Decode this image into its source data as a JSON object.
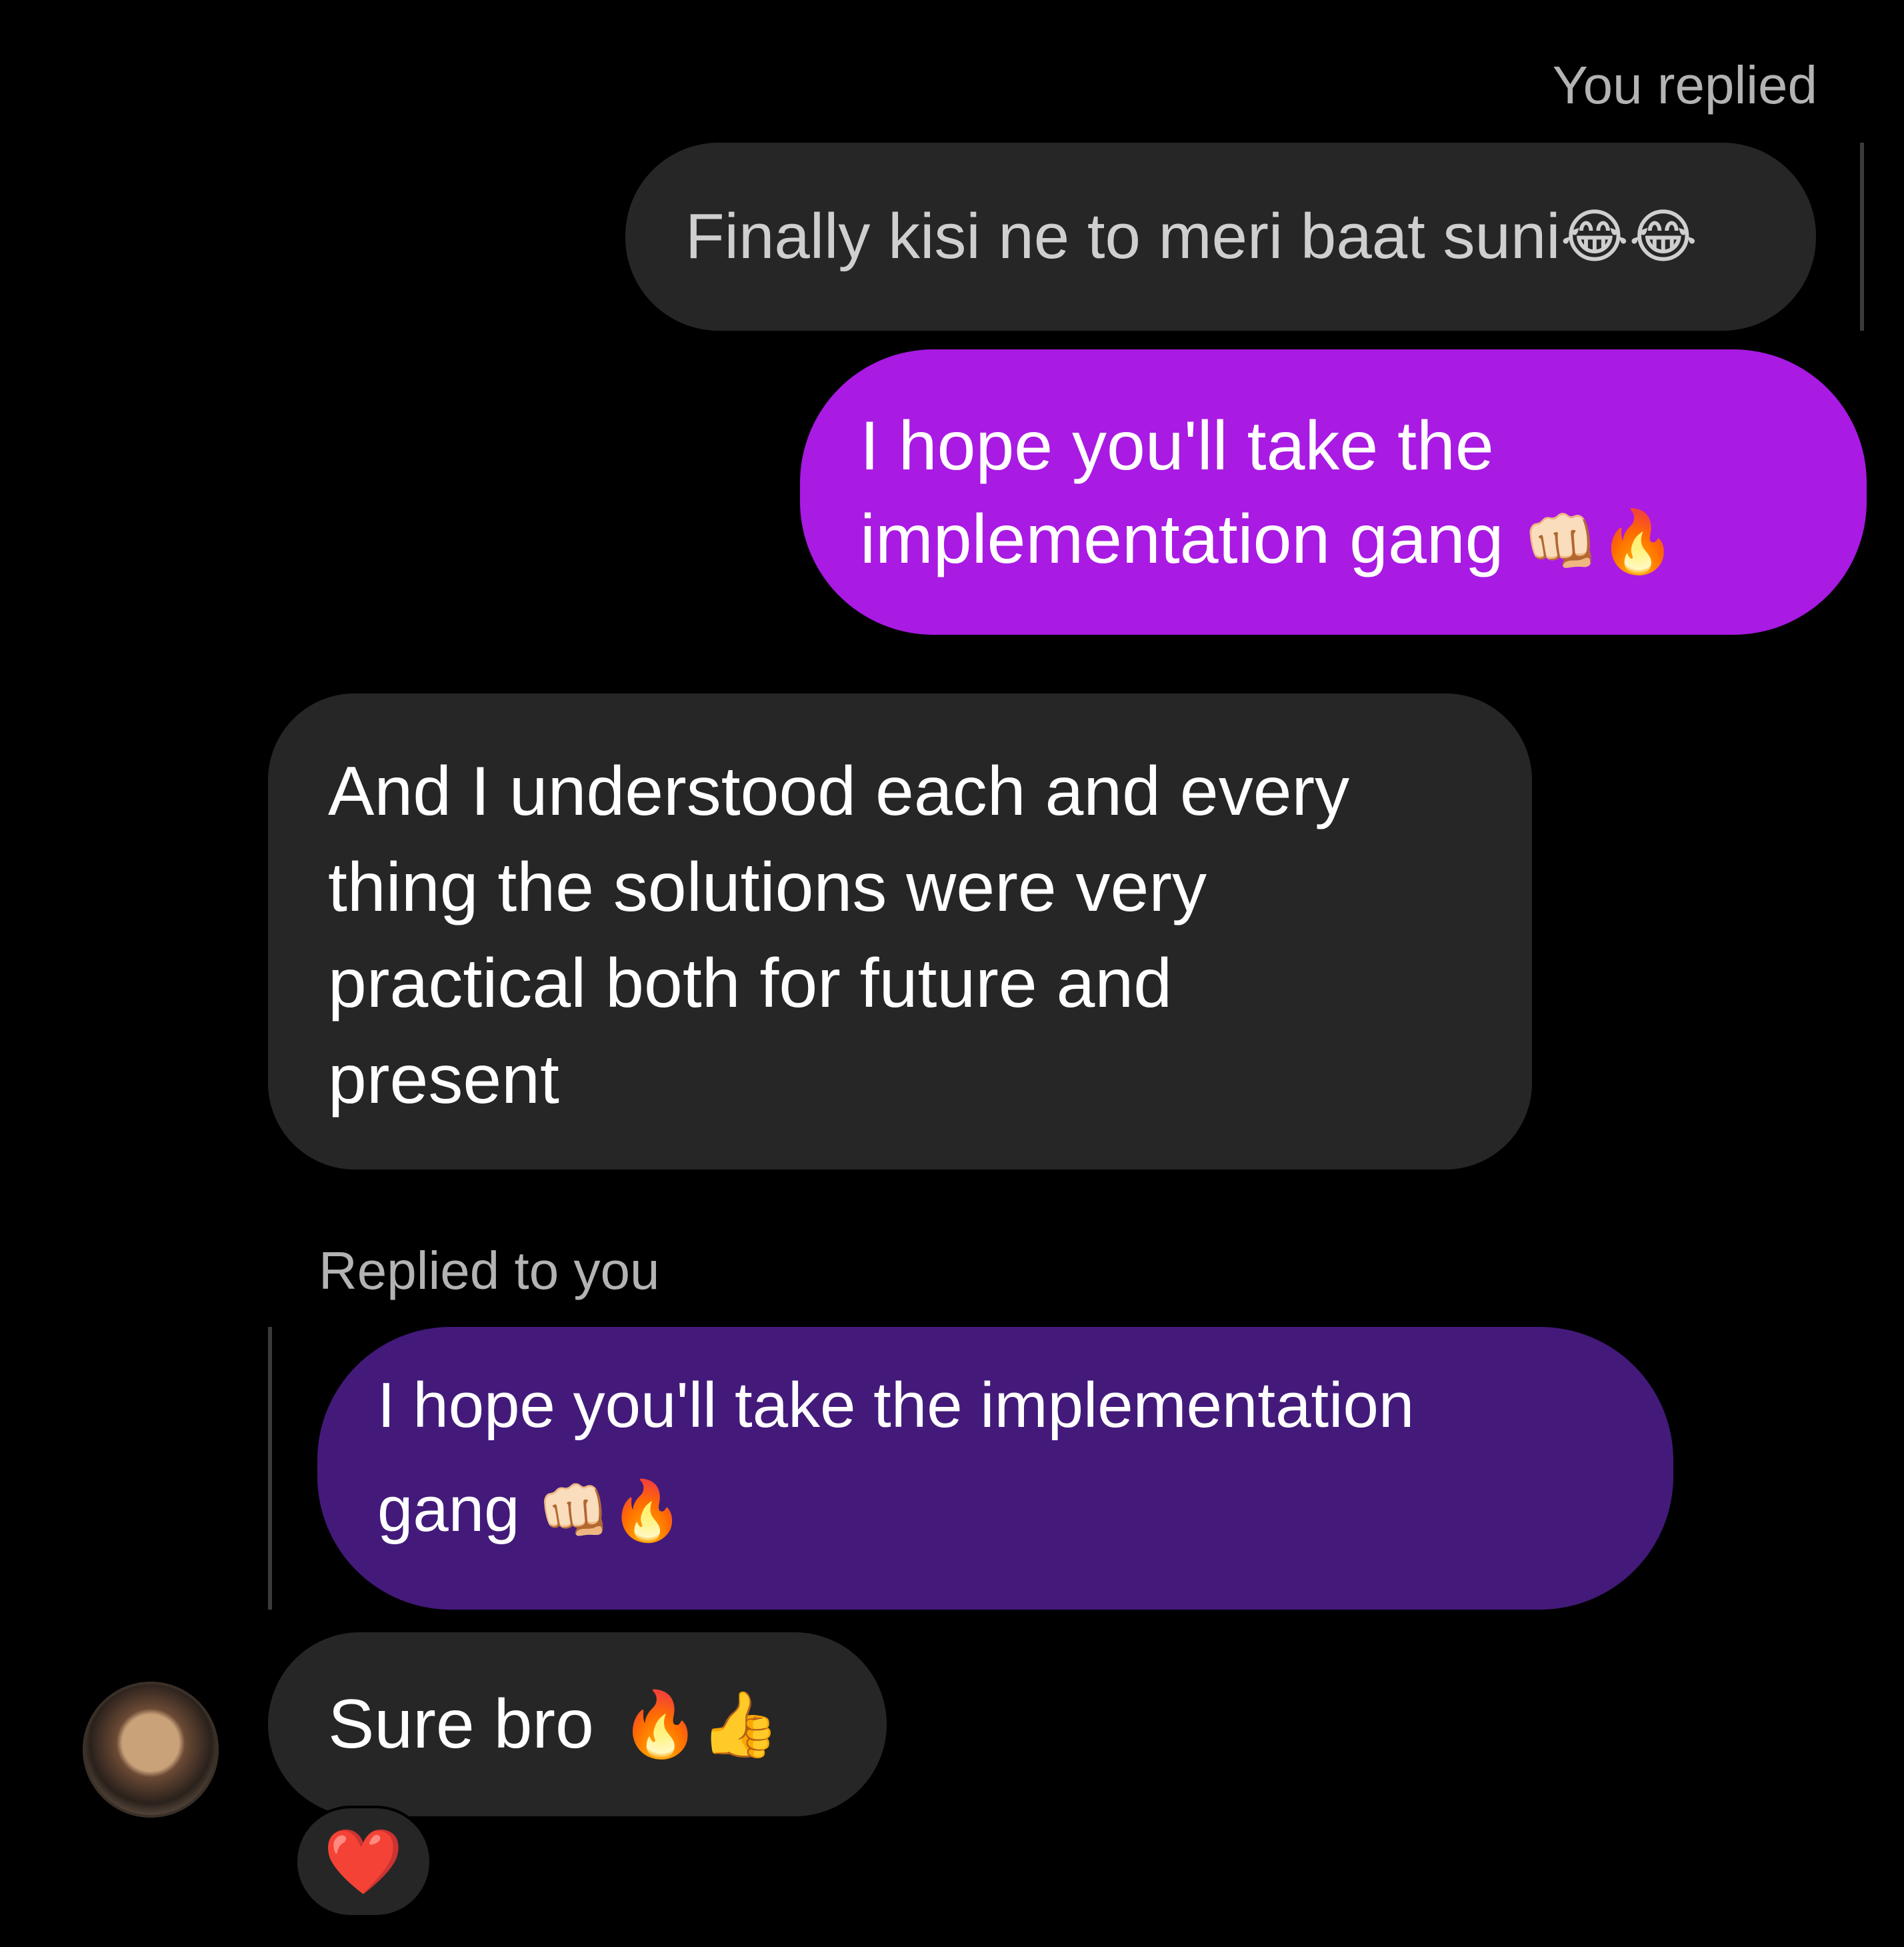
{
  "reply_caption_sent": "You replied",
  "quoted_message": {
    "text": "Finally kisi ne to meri baat suni",
    "emoji": "😂😂"
  },
  "sent_message": {
    "line1": "I hope you'll take the",
    "line2": "implementation gang",
    "emoji": "👊🏻🔥"
  },
  "received_message": {
    "line1": "And I understood each and every",
    "line2": "thing the solutions were very",
    "line3": "practical both for future and",
    "line4": "present"
  },
  "reply_caption_received": "Replied to you",
  "replied_message": {
    "line1": "I hope you'll take the implementation",
    "line2": "gang",
    "emoji": "👊🏻🔥"
  },
  "last_message": {
    "text": "Sure bro",
    "emoji": "🔥👍"
  },
  "reaction": {
    "emoji": "❤️"
  },
  "colors": {
    "background": "#000000",
    "sent_bubble": "#a91ae3",
    "received_bubble": "#262626",
    "replied_bubble": "#431a7a"
  }
}
